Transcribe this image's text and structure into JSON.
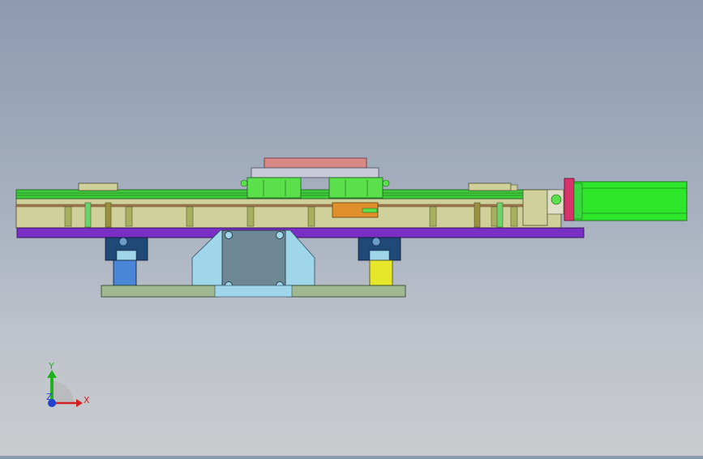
{
  "viewport": {
    "background_top": "#8d9ab0",
    "background_bottom": "#c9cbce"
  },
  "colors": {
    "base_plate": "#7a2fc4",
    "rail_green": "#3fcc3a",
    "carriage_green": "#59e04a",
    "top_plate_pink": "#d98a86",
    "body_khaki": "#cfd09a",
    "motor_green": "#2ee62a",
    "motor_flange_magenta": "#d9336b",
    "bracket_light_blue": "#9fd6ea",
    "bracket_slate": "#6e8794",
    "foot_sage": "#9fb891",
    "block_navy": "#1f4a78",
    "post_blue": "#4a86d8",
    "post_yellow": "#e6e62a",
    "orange_nut": "#e0902a"
  },
  "triad": {
    "x_label": "X",
    "y_label": "Y",
    "z_label": "Z",
    "x_color": "#d42020",
    "y_color": "#20b020",
    "z_color": "#2040d0"
  }
}
